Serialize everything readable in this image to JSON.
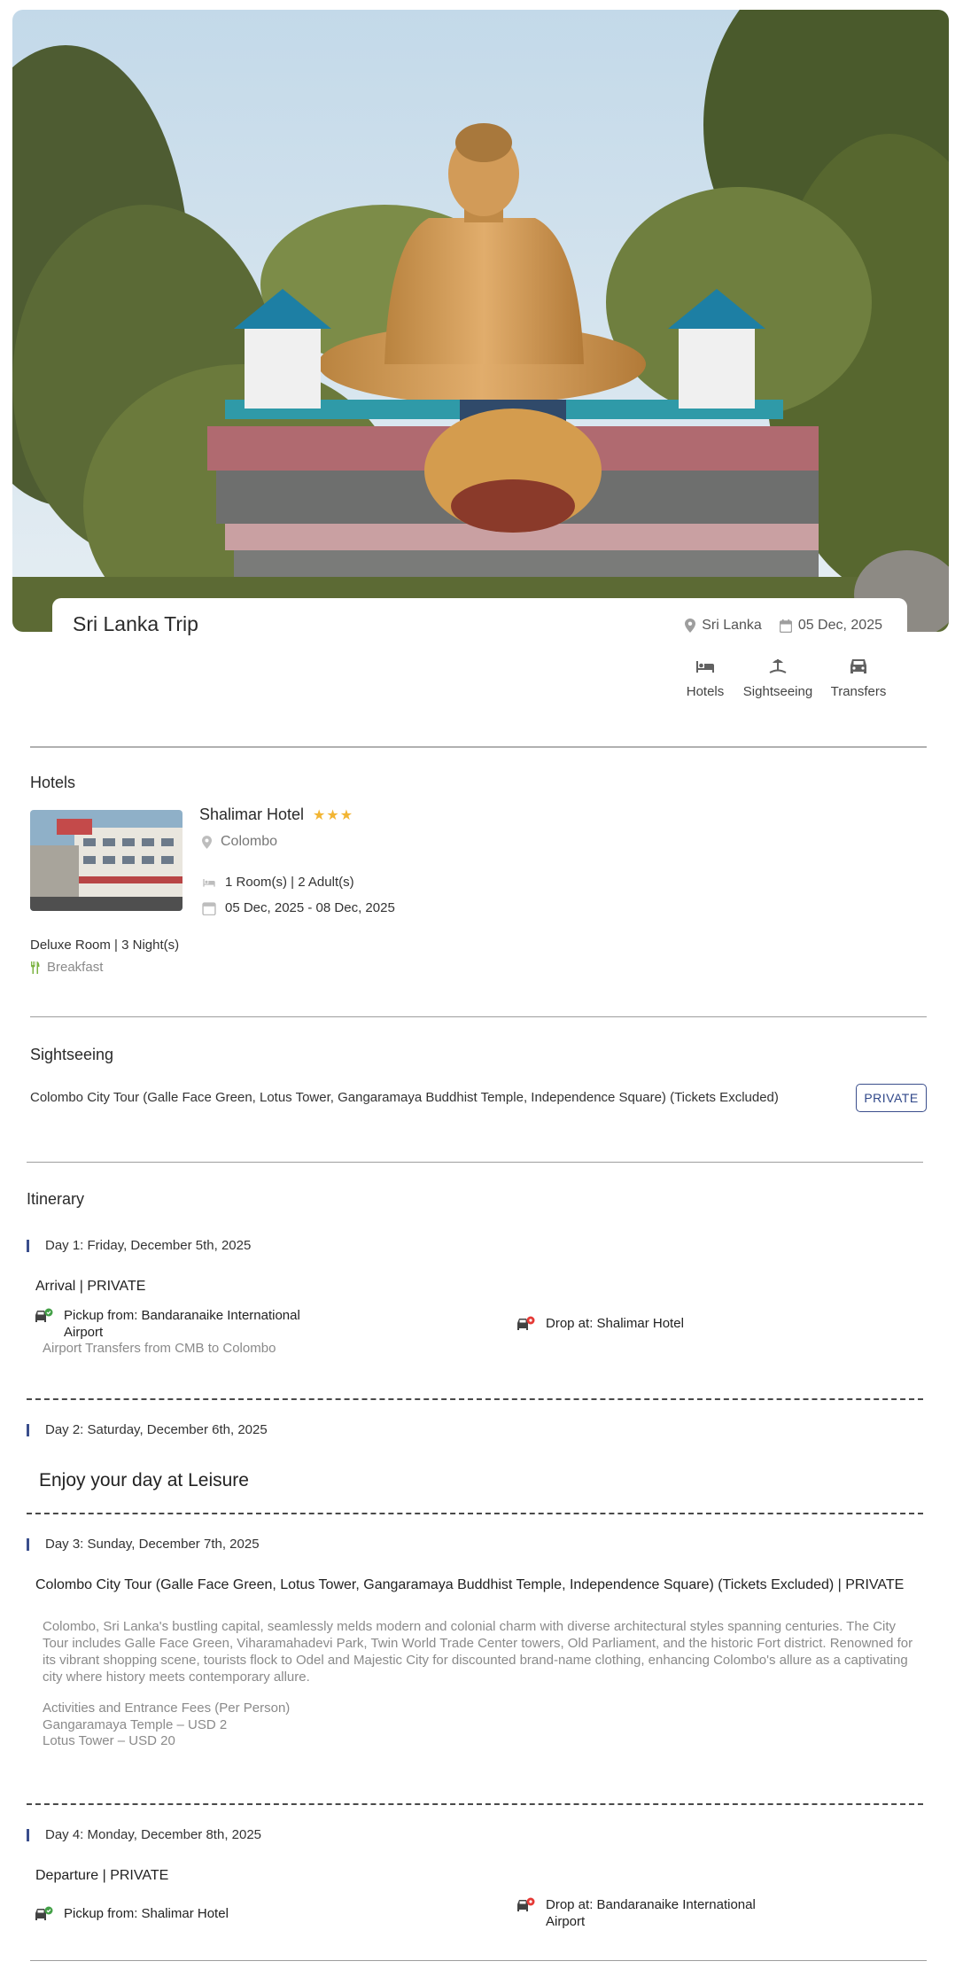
{
  "trip": {
    "title": "Sri Lanka Trip",
    "location": "Sri Lanka",
    "date": "05 Dec, 2025",
    "services": [
      {
        "label": "Hotels",
        "icon": "bed-icon"
      },
      {
        "label": "Sightseeing",
        "icon": "sightseeing-icon"
      },
      {
        "label": "Transfers",
        "icon": "car-icon"
      }
    ]
  },
  "hotels": {
    "section_title": "Hotels",
    "name": "Shalimar Hotel",
    "stars": "★★★",
    "city": "Colombo",
    "rooms": "1 Room(s) | 2 Adult(s)",
    "dates": "05 Dec, 2025 - 08 Dec, 2025",
    "room_type": "Deluxe Room | 3 Night(s)",
    "meal": "Breakfast"
  },
  "sightseeing": {
    "section_title": "Sightseeing",
    "name": "Colombo City Tour (Galle Face Green, Lotus Tower, Gangaramaya Buddhist Temple, Independence Square) (Tickets Excluded)",
    "badge": "PRIVATE"
  },
  "itinerary": {
    "section_title": "Itinerary",
    "days": [
      {
        "label": "Day 1: Friday, December 5th, 2025",
        "title": "Arrival | PRIVATE",
        "pickup": "Pickup from: Bandaranaike International Airport",
        "pickup_line1": "Pickup from: Bandaranaike International",
        "pickup_line2": "Airport",
        "drop": "Drop at: Shalimar Hotel",
        "note": "Airport Transfers from CMB to Colombo"
      },
      {
        "label": "Day 2: Saturday, December 6th, 2025",
        "title": "Enjoy your day at Leisure"
      },
      {
        "label": "Day 3: Sunday, December 7th, 2025",
        "title": "Colombo City Tour (Galle Face Green, Lotus Tower, Gangaramaya Buddhist Temple, Independence Square) (Tickets Excluded) | PRIVATE",
        "description": "Colombo, Sri Lanka's bustling capital, seamlessly melds modern and colonial charm with diverse architectural styles spanning centuries. The City Tour includes Galle Face Green, Viharamahadevi Park, Twin World Trade Center towers, Old Parliament, and the historic Fort district. Renowned for its vibrant shopping scene, tourists flock to Odel and Majestic City for discounted brand-name clothing, enhancing Colombo's allure as a captivating city where history meets contemporary allure.",
        "fees_title": "Activities and Entrance Fees (Per Person)",
        "fees": [
          "Gangaramaya Temple – USD 2",
          "Lotus Tower – USD 20"
        ]
      },
      {
        "label": "Day 4: Monday, December 8th, 2025",
        "title": "Departure | PRIVATE",
        "pickup": "Pickup from: Shalimar Hotel",
        "drop": "Drop at: Bandaranaike International Airport",
        "drop_line1": "Drop at: Bandaranaike International",
        "drop_line2": "Airport"
      }
    ]
  },
  "colors": {
    "accent": "#3a4e8c",
    "star": "#f2b533",
    "pickup_dot": "#43a047",
    "drop_dot": "#e53935"
  }
}
